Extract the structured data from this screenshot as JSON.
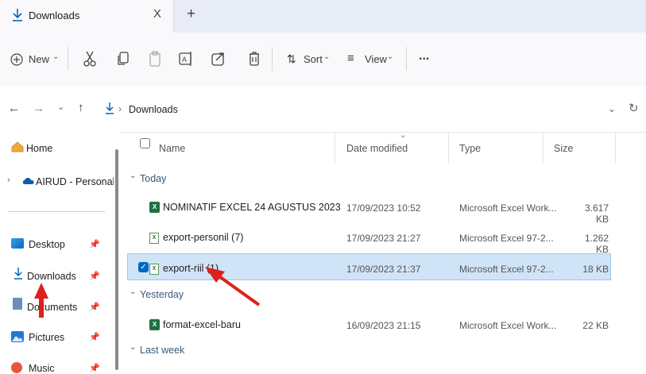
{
  "tab": {
    "title": "Downloads",
    "close": "X",
    "new_tab": "+"
  },
  "toolbar": {
    "new_label": "New",
    "sort_label": "Sort",
    "view_label": "View",
    "more_label": "..."
  },
  "address": {
    "location": "Downloads"
  },
  "sidebar": {
    "items": [
      {
        "label": "Home"
      },
      {
        "label": "AIRUD - Personal"
      },
      {
        "label": "Desktop"
      },
      {
        "label": "Downloads"
      },
      {
        "label": "Documents"
      },
      {
        "label": "Pictures"
      },
      {
        "label": "Music"
      }
    ]
  },
  "columns": {
    "name": "Name",
    "date": "Date modified",
    "type": "Type",
    "size": "Size"
  },
  "groups": {
    "today": "Today",
    "yesterday": "Yesterday",
    "last_week": "Last week"
  },
  "files": [
    {
      "name": "NOMINATIF EXCEL 24 AGUSTUS 2023",
      "date": "17/09/2023 10:52",
      "type": "Microsoft Excel Work...",
      "size": "3.617 KB"
    },
    {
      "name": "export-personil (7)",
      "date": "17/09/2023 21:27",
      "type": "Microsoft Excel 97-2...",
      "size": "1.262 KB"
    },
    {
      "name": "export-riil (1)",
      "date": "17/09/2023 21:37",
      "type": "Microsoft Excel 97-2...",
      "size": "18 KB"
    },
    {
      "name": "format-excel-baru",
      "date": "16/09/2023 21:15",
      "type": "Microsoft Excel Work...",
      "size": "22 KB"
    }
  ],
  "colors": {
    "selection": "#cfe4f7",
    "accent": "#0067c0",
    "annotation_arrow": "#e0201b"
  }
}
